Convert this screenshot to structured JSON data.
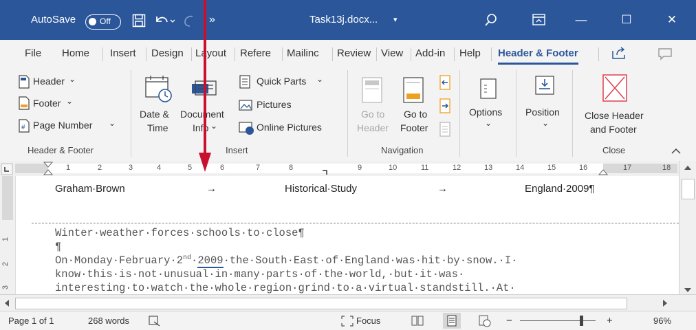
{
  "titlebar": {
    "autosave_label": "AutoSave",
    "autosave_state": "Off",
    "more_label": "»",
    "doc_title": "Task13j.docx...",
    "title_caret": "▾",
    "minimize": "—",
    "maximize": "☐",
    "close": "✕"
  },
  "tabs": [
    "File",
    "Home",
    "Insert",
    "Design",
    "Layout",
    "Refere",
    "Mailinc",
    "Review",
    "View",
    "Add-in",
    "Help",
    "Header & Footer"
  ],
  "ribbon": {
    "header_label": "Header",
    "footer_label": "Footer",
    "page_number_label": "Page Number",
    "group_header_footer": "Header & Footer",
    "date_time_line1": "Date &",
    "date_time_line2": "Time",
    "doc_info_line1": "Document",
    "doc_info_line2": "Info",
    "quick_parts_label": "Quick Parts",
    "pictures_label": "Pictures",
    "online_pictures_label": "Online Pictures",
    "group_insert": "Insert",
    "goto_header_line1": "Go to",
    "goto_header_line2": "Header",
    "goto_footer_line1": "Go to",
    "goto_footer_line2": "Footer",
    "group_navigation": "Navigation",
    "options_label": "Options",
    "position_label": "Position",
    "close_hf_line1": "Close Header",
    "close_hf_line2": "and Footer",
    "group_close": "Close",
    "dropdown_caret": "⌄"
  },
  "ruler": {
    "numbers": [
      "1",
      "2",
      "3",
      "4",
      "5",
      "6",
      "7",
      "8",
      "9",
      "10",
      "11",
      "12",
      "13",
      "14",
      "15",
      "16",
      "17",
      "18"
    ],
    "vertical_numbers": [
      "1",
      "2",
      "3"
    ]
  },
  "document": {
    "header_left": "Graham·Brown",
    "tab_arrow": "→",
    "header_center": "Historical·Study",
    "header_right": "England·2009¶",
    "line1": "Winter·weather·forces·schools·to·close¶",
    "line2": "¶",
    "line3_pre": "On·Monday·February·2",
    "line3_sup": "nd",
    "line3_year": "2009",
    "line3_post": "·the·South·East·of·England·was·hit·by·snow.·I·",
    "line4": "know·this·is·not·unusual·in·many·parts·of·the·world,·but·it·was·",
    "line5": "interesting·to·watch·the·whole·region·grind·to·a·virtual·standstill.·At·"
  },
  "status": {
    "page": "Page 1 of 1",
    "words": "268 words",
    "focus": "Focus",
    "zoom": "96%",
    "zoom_minus": "−",
    "zoom_plus": "+"
  },
  "colors": {
    "accent": "#2b579a",
    "arrow": "#c8102e",
    "close_red": "#e04050"
  }
}
